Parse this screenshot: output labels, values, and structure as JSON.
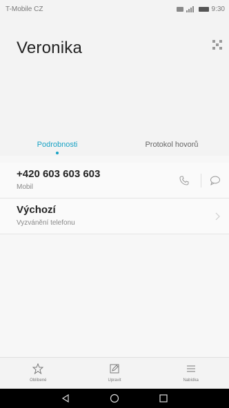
{
  "status_bar": {
    "carrier": "T-Mobile CZ",
    "time": "9:30"
  },
  "contact": {
    "name": "Veronika"
  },
  "tabs": [
    {
      "label": "Podrobnosti",
      "active": true
    },
    {
      "label": "Protokol hovorů",
      "active": false
    }
  ],
  "phone_row": {
    "number": "+420 603 603 603",
    "type": "Mobil"
  },
  "ringtone_row": {
    "title": "Výchozí",
    "subtitle": "Vyzvánění telefonu"
  },
  "bottom_bar": {
    "items": [
      {
        "label": "Oblíbené",
        "icon": "star-icon"
      },
      {
        "label": "Upravit",
        "icon": "edit-icon"
      },
      {
        "label": "Nabídka",
        "icon": "menu-icon"
      }
    ]
  },
  "colors": {
    "accent": "#17a2c4"
  }
}
